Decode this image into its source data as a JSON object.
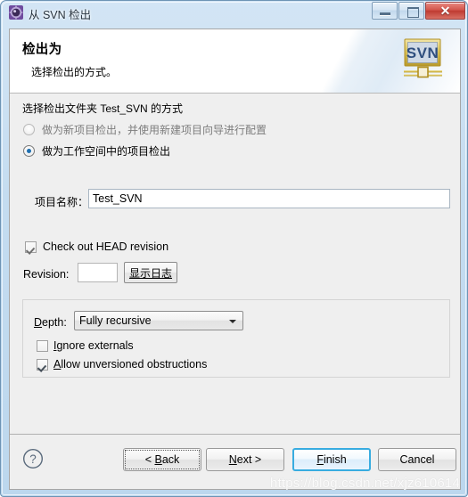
{
  "window": {
    "title": "从 SVN 检出",
    "icon": "svn-gear-icon",
    "controls": {
      "minimize": "minimize-button",
      "maximize": "maximize-button",
      "close_glyph": "✕"
    }
  },
  "header": {
    "title": "检出为",
    "subtitle": "选择检出的方式。",
    "logo_text": "SVN"
  },
  "content": {
    "choose_label": "选择检出文件夹 Test_SVN 的方式",
    "radios": [
      {
        "label": "做为新项目检出，并使用新建项目向导进行配置",
        "selected": false,
        "enabled": false
      },
      {
        "label": "做为工作空间中的项目检出",
        "selected": true,
        "enabled": true
      }
    ],
    "project_name": {
      "label": "项目名称：",
      "value": "Test_SVN",
      "placeholder": ""
    },
    "head_revision": {
      "label": "Check out HEAD revision",
      "checked": true
    },
    "revision": {
      "label": "Revision:",
      "value": "",
      "placeholder": ""
    },
    "show_log_button": "显示日志",
    "depth_group": {
      "depth_label_prefix": "D",
      "depth_label_rest": "epth:",
      "depth_value": "Fully recursive",
      "options": [
        "Fully recursive"
      ],
      "checkboxes": [
        {
          "prefix": "I",
          "rest": "gnore externals",
          "checked": false
        },
        {
          "prefix": "A",
          "rest": "llow unversioned obstructions",
          "checked": true
        }
      ]
    }
  },
  "buttons": {
    "help": "?",
    "back": {
      "pre": "< ",
      "accel": "B",
      "post": "ack"
    },
    "next": {
      "pre": "",
      "accel": "N",
      "post": "ext >"
    },
    "finish": {
      "pre": "",
      "accel": "F",
      "post": "inish"
    },
    "cancel": {
      "pre": "",
      "accel": "",
      "post": "Cancel"
    }
  },
  "watermark": "https://blog.csdn.net/xjz610614",
  "colors": {
    "frame": "#6d94b5",
    "accent_blue": "#1f6fb0",
    "finish_border": "#38ace0",
    "close_red": "#bf3b32",
    "logo_gold": "#c8a93a"
  }
}
